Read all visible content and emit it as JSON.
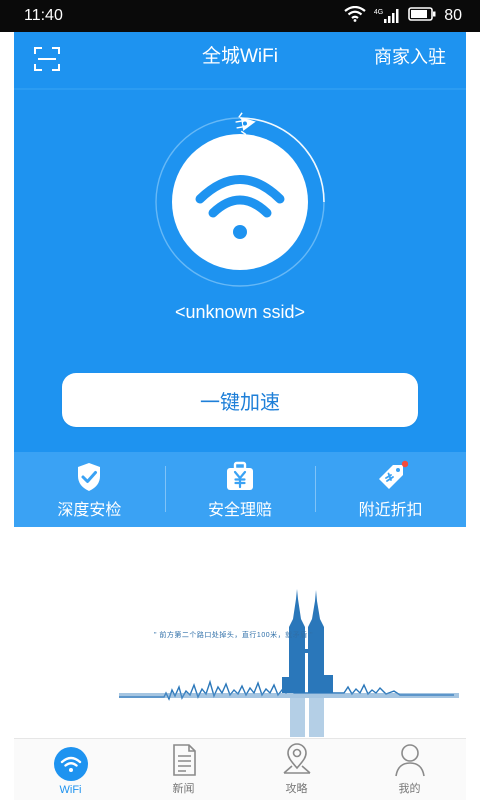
{
  "status_bar": {
    "time": "11:40",
    "network": "4G",
    "battery": "80"
  },
  "header": {
    "title": "全城WiFi",
    "merchant_label": "商家入驻"
  },
  "wifi": {
    "ssid": "<unknown ssid>",
    "boost_label": "一键加速"
  },
  "features": [
    {
      "label": "深度安检",
      "icon": "shield-check-icon"
    },
    {
      "label": "安全理赔",
      "icon": "yuan-briefcase-icon"
    },
    {
      "label": "附近折扣",
      "icon": "discount-tag-icon"
    }
  ],
  "banner": {
    "quote": "\" 前方第二个路口处掉头，直行100米，就矛盾 \""
  },
  "tabs": [
    {
      "label": "WiFi",
      "icon": "wifi-icon",
      "active": true
    },
    {
      "label": "新闻",
      "icon": "news-document-icon",
      "active": false
    },
    {
      "label": "攻略",
      "icon": "location-pin-icon",
      "active": false
    },
    {
      "label": "我的",
      "icon": "person-icon",
      "active": false
    }
  ],
  "colors": {
    "primary": "#1E93F0",
    "feature_bar": "#3AA2F4",
    "button_text": "#1E7FD8",
    "status_bar": "#0A0A0A"
  }
}
